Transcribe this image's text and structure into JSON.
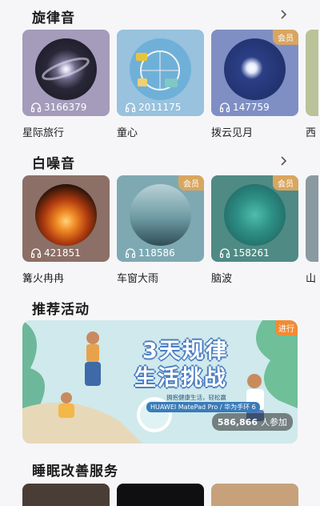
{
  "sections": {
    "melody": {
      "title": "旋律音",
      "cards": [
        {
          "label": "星际旅行",
          "count": "3166379",
          "vip": ""
        },
        {
          "label": "童心",
          "count": "2011175",
          "vip": ""
        },
        {
          "label": "拨云见月",
          "count": "147759",
          "vip": "会员"
        }
      ],
      "peek_label": "西"
    },
    "white_noise": {
      "title": "白噪音",
      "cards": [
        {
          "label": "篝火冉冉",
          "count": "421851",
          "vip": ""
        },
        {
          "label": "车窗大雨",
          "count": "118586",
          "vip": "会员"
        },
        {
          "label": "脑波",
          "count": "158261",
          "vip": "会员"
        }
      ],
      "peek_label": "山"
    },
    "activities": {
      "title": "推荐活动",
      "banner": {
        "title_line1": "3天规律",
        "title_line2": "生活挑战",
        "subtitle": "拥抱健康生活，轻松赢",
        "prize": "HUAWEI MatePad Pro / 华为手环 6",
        "participants_count": "586,866",
        "participants_suffix": "人参加",
        "corner_tag": "进行"
      }
    },
    "sleep_service": {
      "title": "睡眠改善服务"
    }
  },
  "icons": {
    "chevron": "chevron-right-icon",
    "headphones": "headphones-icon"
  },
  "colors": {
    "vip_badge": "#d9a660",
    "background": "#f6f6f8"
  }
}
